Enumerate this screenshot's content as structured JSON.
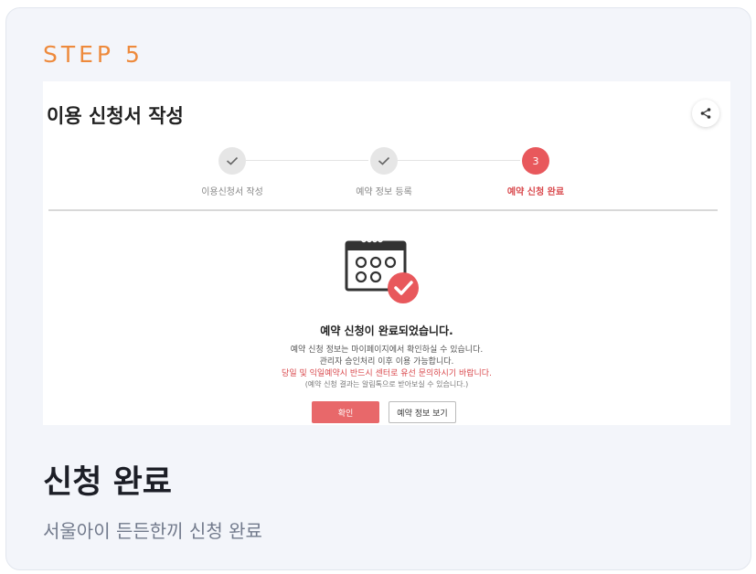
{
  "step_label": "STEP 5",
  "screenshot": {
    "title": "이용 신청서 작성",
    "steps": [
      {
        "label": "이용신청서 작성",
        "state": "done",
        "number": ""
      },
      {
        "label": "예약 정보 등록",
        "state": "done",
        "number": ""
      },
      {
        "label": "예약 신청 완료",
        "state": "active",
        "number": "3"
      }
    ],
    "complete_title": "예약 신청이 완료되었습니다.",
    "lines": [
      "예약 신청 정보는 마이페이지에서 확인하실 수 있습니다.",
      "관리자 승인처리 이후 이용 가능합니다.",
      "당일 및 익일예약시 반드시 센터로 유선 문의하시기 바랍니다.",
      "(예약 신청 결과는 알림톡으로 받아보실 수 있습니다.)"
    ],
    "confirm_button": "확인",
    "view_button": "예약 정보 보기"
  },
  "card": {
    "title": "신청 완료",
    "subtitle": "서울아이 든든한끼 신청 완료"
  },
  "colors": {
    "step_label": "#ee8a3c",
    "accent_red": "#e8585c",
    "card_bg": "#f3f5fa"
  }
}
